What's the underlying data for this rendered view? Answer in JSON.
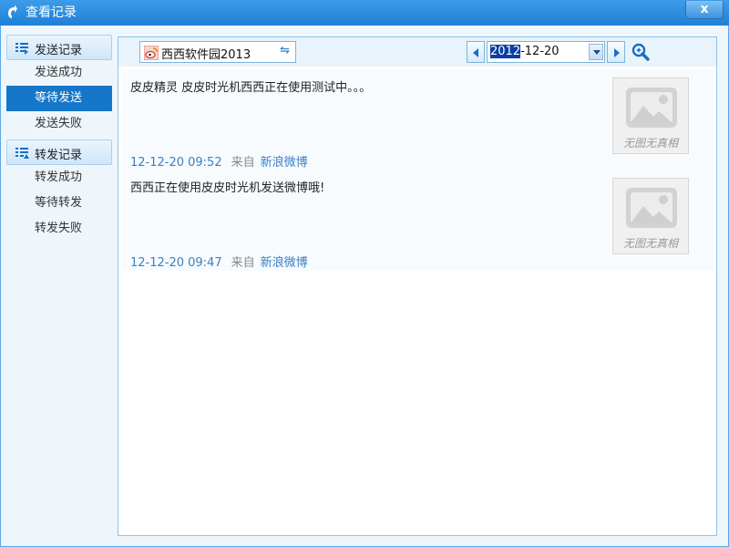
{
  "window": {
    "title": "查看记录",
    "close_label": "x"
  },
  "sidebar": {
    "groups": [
      {
        "label": "发送记录",
        "items": [
          "发送成功",
          "等待发送",
          "发送失败"
        ]
      },
      {
        "label": "转发记录",
        "items": [
          "转发成功",
          "等待转发",
          "转发失败"
        ]
      }
    ],
    "selected": "等待发送"
  },
  "toolbar": {
    "account": "西西软件园2013",
    "swap_icon": "⇋",
    "date_year": "2012",
    "date_rest": "-12-20"
  },
  "posts": [
    {
      "text": "皮皮精灵 皮皮时光机西西正在使用测试中。。。",
      "time": "12-12-20 09:52",
      "from_label": "来自",
      "source": "新浪微博",
      "thumb_caption": "无图无真相"
    },
    {
      "text": "西西正在使用皮皮时光机发送微博哦!",
      "time": "12-12-20 09:47",
      "from_label": "来自",
      "source": "新浪微博",
      "thumb_caption": "无图无真相"
    }
  ],
  "colors": {
    "accent": "#1677c8",
    "link": "#3b7fc4",
    "titlebar": "#2a8ae0"
  }
}
